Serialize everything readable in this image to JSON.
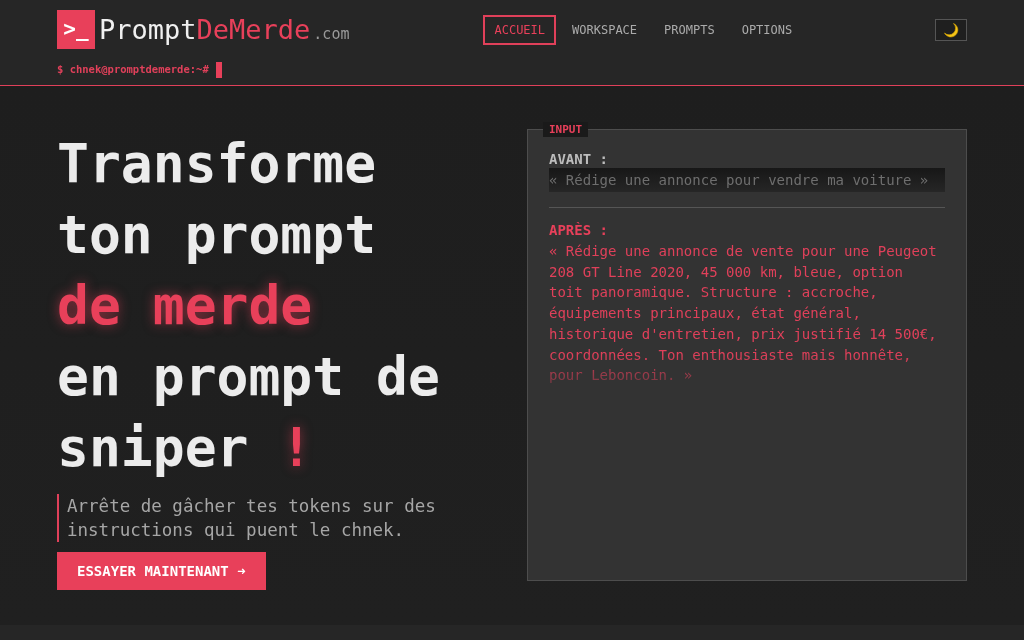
{
  "header": {
    "logo": {
      "badge": ">_",
      "name": "Prompt",
      "name_accent": "DeMerde",
      "suffix": ".com"
    },
    "nav": [
      {
        "label": "ACCUEIL",
        "selected": true
      },
      {
        "label": "WORKSPACE",
        "selected": false
      },
      {
        "label": "PROMPTS",
        "selected": false
      },
      {
        "label": "OPTIONS",
        "selected": false
      }
    ],
    "terminal_prompt": "$ chnek@promptdemerde:~#"
  },
  "hero": {
    "title_lines": [
      [
        {
          "text": "Transforme",
          "accent": false
        }
      ],
      [
        {
          "text": "ton prompt",
          "accent": false
        }
      ],
      [
        {
          "text": "de merde",
          "accent": true
        }
      ],
      [
        {
          "text": "en prompt de",
          "accent": false
        }
      ],
      [
        {
          "text": "sniper",
          "accent": false
        },
        {
          "text": "!",
          "accent": true
        }
      ]
    ],
    "tagline": "Arrête de gâcher tes tokens sur des instructions qui puent le chnek.",
    "cta_button": "ESSAYER MAINTENANT ➜"
  },
  "demo_panel": {
    "tag": "INPUT",
    "before_label": "AVANT :",
    "before_text": "« Rédige une annonce pour vendre ma voiture »",
    "after_label": "APRÈS :",
    "after_text": "« Rédige une annonce de vente pour une Peugeot 208 GT Line 2020, 45 000 km, bleue, option toit panoramique. Structure : accroche, équipements principaux, état général, historique d'entretien, prix justifié 14 500€, coordonnées. Ton enthousiaste mais honnête, pour Leboncoin. »"
  }
}
